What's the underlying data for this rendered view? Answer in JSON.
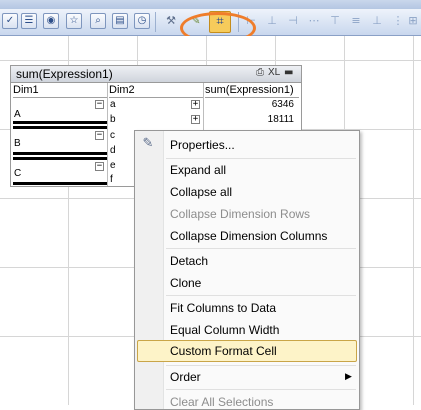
{
  "toolbar": {
    "icons": [
      "check-icon",
      "list-icon",
      "eye-icon",
      "star-icon",
      "search-icon",
      "sheet-icon",
      "clock-icon",
      "tools-icon",
      "brush-icon",
      "format-cell-icon",
      "align-icons"
    ]
  },
  "pivot": {
    "title": "sum(Expression1)",
    "caption_xl": "XL",
    "headers": {
      "dim1": "Dim1",
      "dim2": "Dim2",
      "expr": "sum(Expression1)"
    },
    "dim1_values": [
      "A",
      "B",
      "C"
    ],
    "dim2_values": [
      "a",
      "b",
      "c",
      "d",
      "e",
      "f"
    ],
    "expr_values": [
      "6346",
      "18111"
    ]
  },
  "menu": {
    "items": {
      "properties": "Properties...",
      "expand_all": "Expand all",
      "collapse_all": "Collapse all",
      "collapse_dim_rows": "Collapse Dimension Rows",
      "collapse_dim_cols": "Collapse Dimension Columns",
      "detach": "Detach",
      "clone": "Clone",
      "fit_columns": "Fit Columns to Data",
      "equal_width": "Equal Column Width",
      "custom_format_cell": "Custom Format Cell",
      "order": "Order",
      "clear_all_selections": "Clear All Selections"
    },
    "highlighted": "Custom Format Cell"
  },
  "colors": {
    "accent_highlight": "#ef7d2b",
    "menu_hover": "#fdf3c8"
  }
}
